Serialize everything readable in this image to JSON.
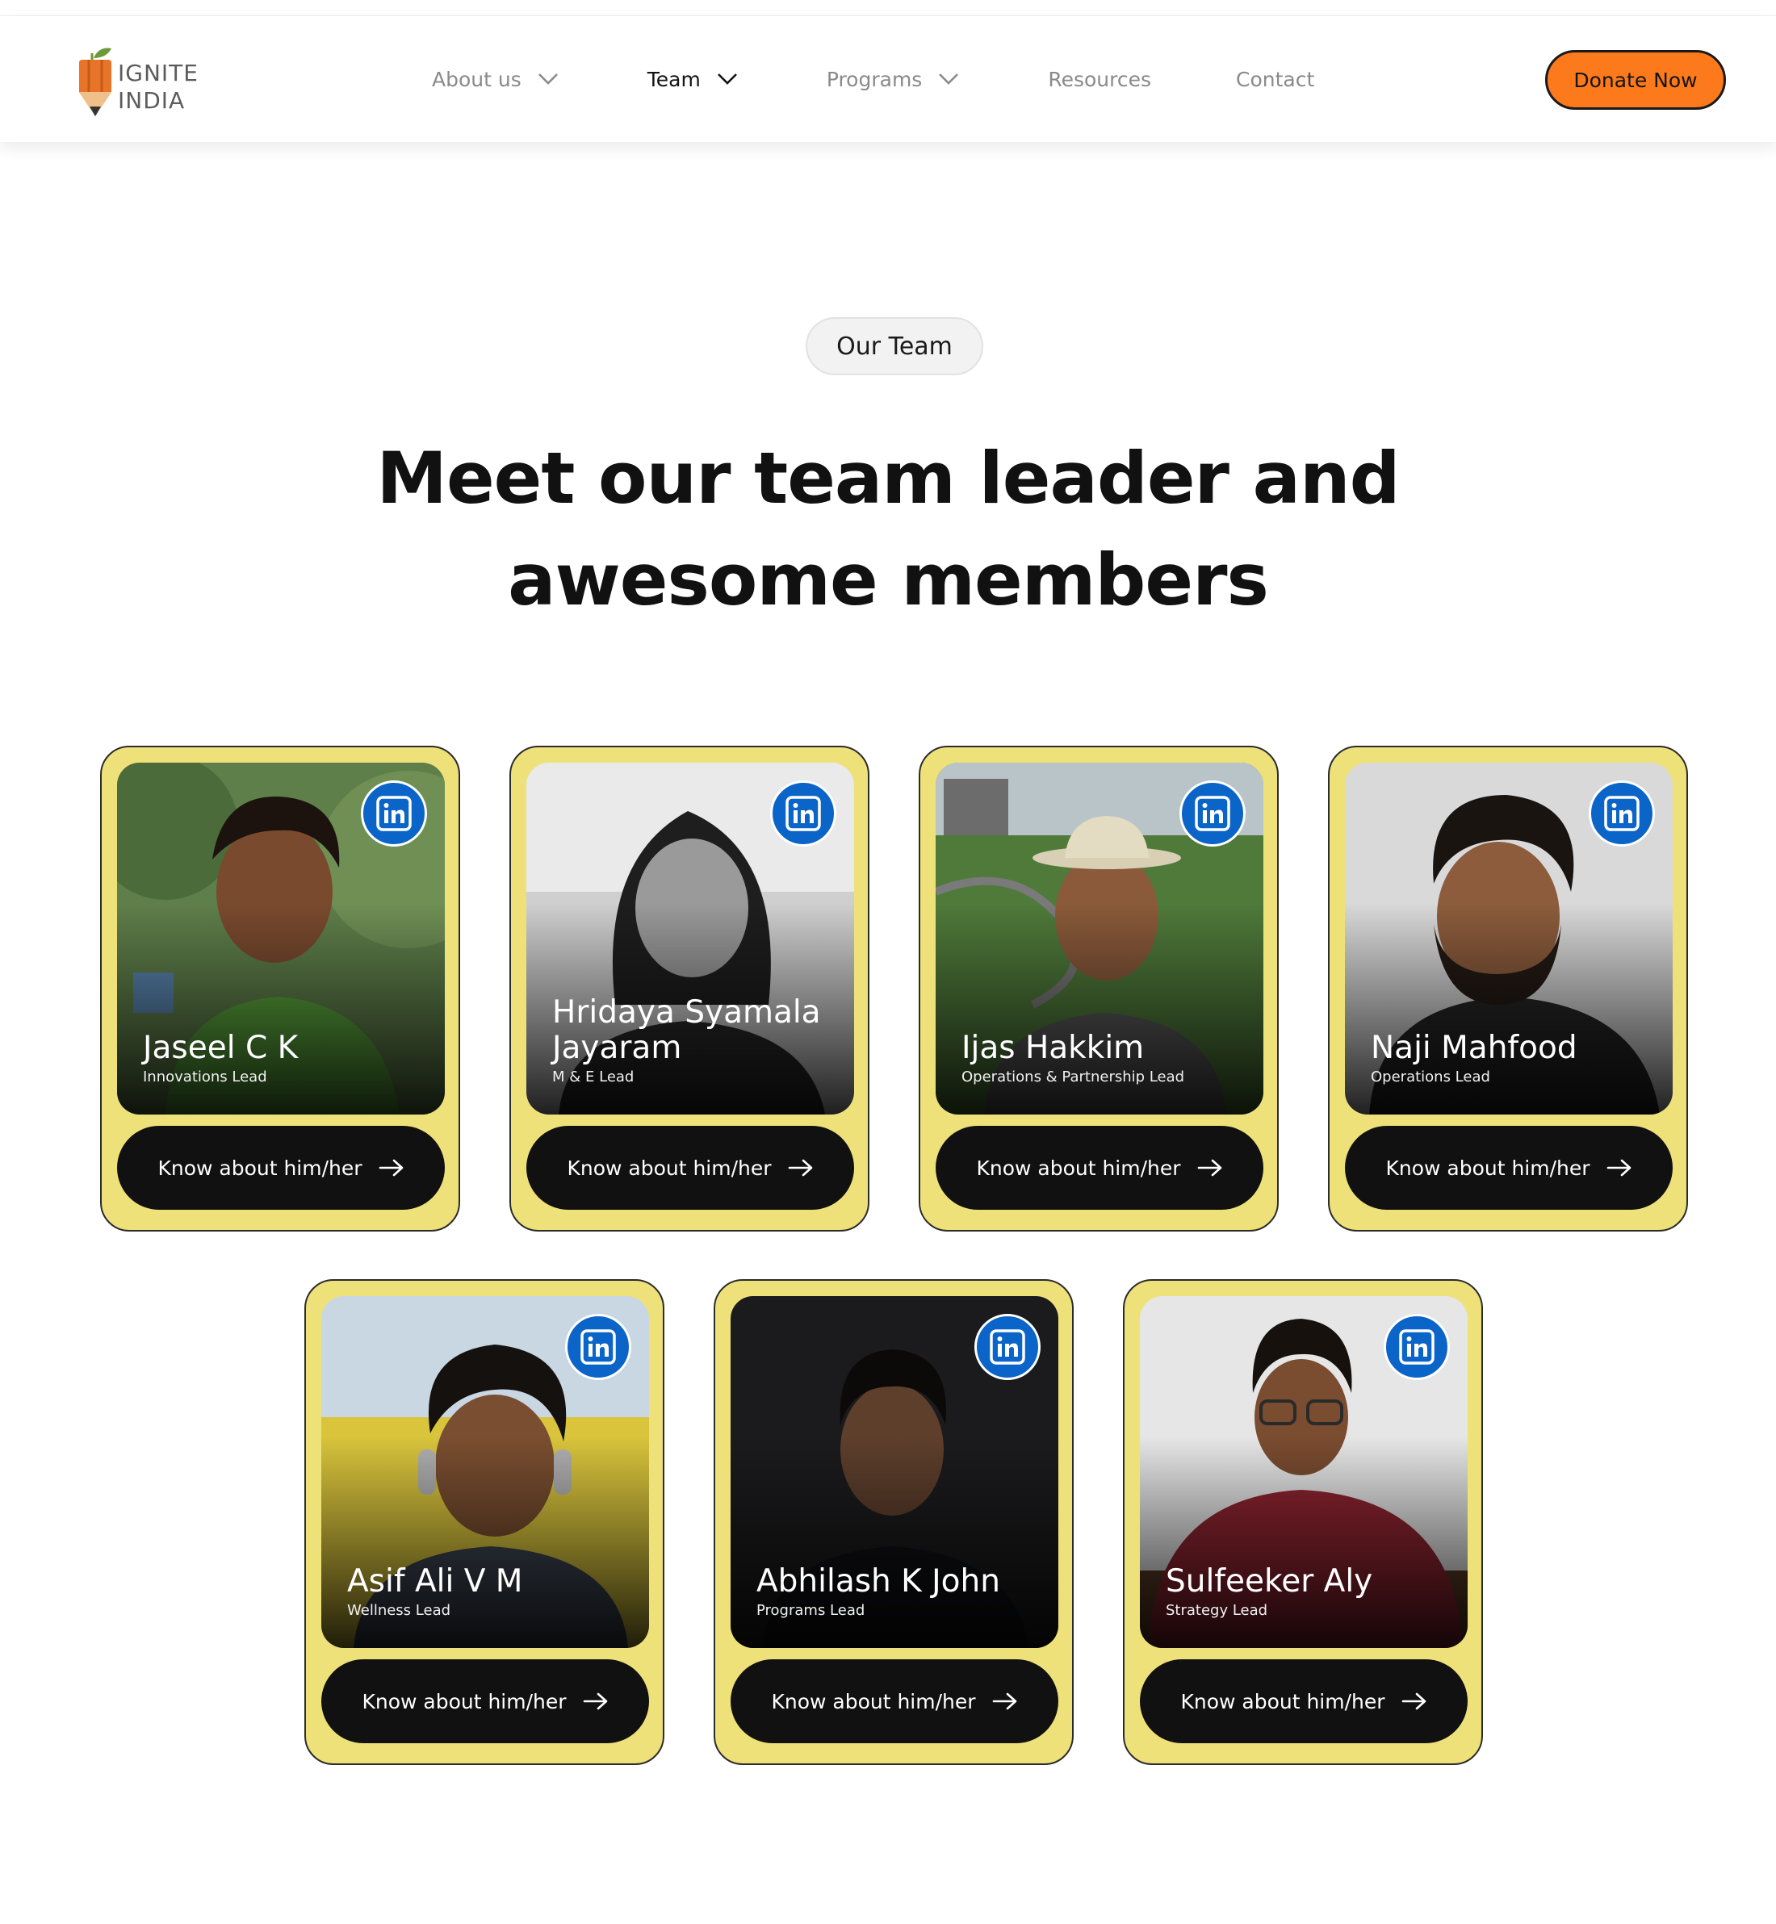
{
  "brand": {
    "line1": "IGNITE",
    "line2": "INDIA",
    "colors": {
      "accent": "#fc7a1c",
      "card": "#efe17a",
      "linkedin": "#0b64c7"
    }
  },
  "nav": {
    "items": [
      {
        "label": "About us",
        "has_dropdown": true
      },
      {
        "label": "Team",
        "has_dropdown": true,
        "active": true
      },
      {
        "label": "Programs",
        "has_dropdown": true
      },
      {
        "label": "Resources",
        "has_dropdown": false
      },
      {
        "label": "Contact",
        "has_dropdown": false
      }
    ],
    "donate_label": "Donate Now"
  },
  "section": {
    "pill": "Our Team",
    "heading_line1": "Meet our team leader and",
    "heading_line2": "awesome members"
  },
  "members": [
    {
      "name": "Jaseel C K",
      "role": "Innovations Lead",
      "button": "Know about him/her"
    },
    {
      "name": "Hridaya Syamala Jayaram",
      "role": "M & E Lead",
      "button": "Know about him/her"
    },
    {
      "name": "Ijas Hakkim",
      "role": "Operations & Partnership Lead",
      "button": "Know about him/her"
    },
    {
      "name": "Naji Mahfood",
      "role": "Operations Lead",
      "button": "Know about him/her"
    },
    {
      "name": "Asif Ali V M",
      "role": "Wellness Lead",
      "button": "Know about him/her"
    },
    {
      "name": "Abhilash K John",
      "role": "Programs Lead",
      "button": "Know about him/her"
    },
    {
      "name": "Sulfeeker Aly",
      "role": "Strategy Lead",
      "button": "Know about him/her"
    }
  ]
}
